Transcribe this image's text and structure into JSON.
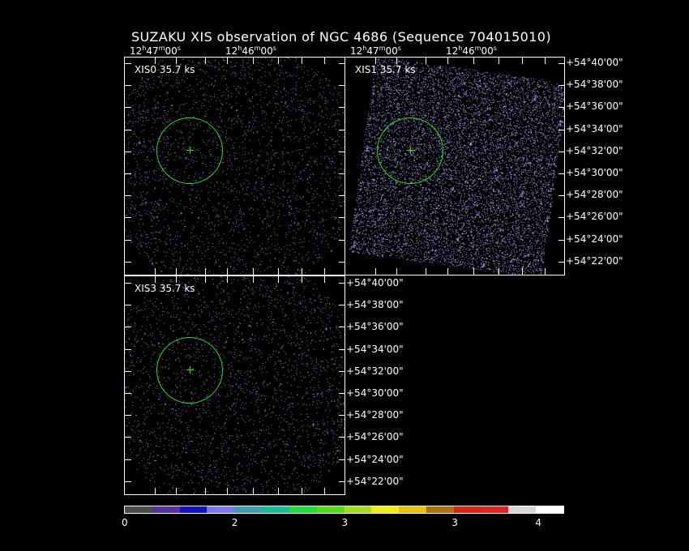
{
  "title": "SUZAKU XIS observation of NGC 4686  (Sequence 704015010)",
  "panels": [
    {
      "id": "xis0",
      "label": "XIS0 35.7 ks",
      "dot_color": "#8c8cd8",
      "density": 0.035
    },
    {
      "id": "xis1",
      "label": "XIS1 35.7 ks",
      "dot_color": "#9a9ae6",
      "density": 0.16
    },
    {
      "id": "xis3",
      "label": "XIS3 35.7 ks",
      "dot_color": "#8c8cd8",
      "density": 0.035
    }
  ],
  "ra_labels": {
    "left": {
      "h": "12",
      "m": "47",
      "s": "00"
    },
    "right": {
      "h": "12",
      "m": "46",
      "s": "00"
    }
  },
  "dec_labels": [
    "+54°40'00\"",
    "+54°38'00\"",
    "+54°36'00\"",
    "+54°34'00\"",
    "+54°32'00\"",
    "+54°30'00\"",
    "+54°28'00\"",
    "+54°26'00\"",
    "+54°24'00\"",
    "+54°22'00\""
  ],
  "circle_color": "#22dd22",
  "colorbar": {
    "colors": [
      "#4a4a4a",
      "#5a2ea8",
      "#1010d0",
      "#7878f0",
      "#3aa0b0",
      "#10c090",
      "#18e038",
      "#50e010",
      "#a0e010",
      "#f0f000",
      "#f0c000",
      "#b07010",
      "#e02010",
      "#e82020",
      "#d8d8d8",
      "#ffffff"
    ],
    "labels": [
      {
        "text": "0",
        "pos": 0.0
      },
      {
        "text": "2",
        "pos": 0.25
      },
      {
        "text": "3",
        "pos": 0.5
      },
      {
        "text": "3",
        "pos": 0.75
      },
      {
        "text": "4",
        "pos": 0.94
      }
    ]
  }
}
